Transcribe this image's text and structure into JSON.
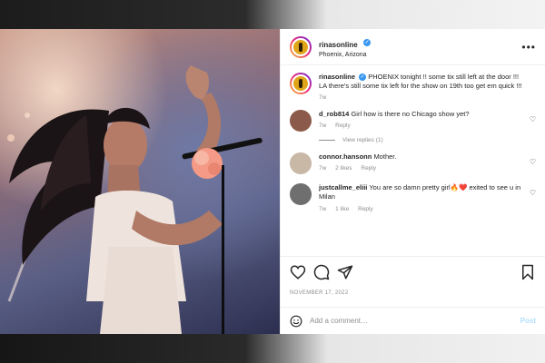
{
  "post": {
    "username": "rinasonline",
    "location": "Phoenix, Arizona",
    "caption": "PHOENIX tonight !! some tix still left at the door !!! LA there's still some tix left for the show on 19th too get em quick !!!",
    "caption_age": "7w",
    "date": "NOVEMBER 17, 2022"
  },
  "comments": [
    {
      "username": "d_rob814",
      "text": "Girl how is there no Chicago show yet?",
      "age": "7w",
      "likes": "",
      "reply_label": "Reply",
      "view_replies": "View replies (1)"
    },
    {
      "username": "connor.hansonn",
      "text": "Mother.",
      "age": "7w",
      "likes": "2 likes",
      "reply_label": "Reply"
    },
    {
      "username": "justcallme_eliii",
      "text": "You are so damn pretty girl🔥❤️ exited to see u in Milan",
      "age": "7w",
      "likes": "1 like",
      "reply_label": "Reply"
    }
  ],
  "add_comment": {
    "placeholder": "Add a comment…",
    "post_label": "Post"
  },
  "icons": [
    "more-icon",
    "heart-icon",
    "comment-icon",
    "share-icon",
    "save-icon",
    "emoji-icon",
    "verified-icon"
  ],
  "colors": {
    "verified": "#3897f0",
    "post_button": "#b2dffc",
    "meta_text": "#8e8e8e"
  }
}
